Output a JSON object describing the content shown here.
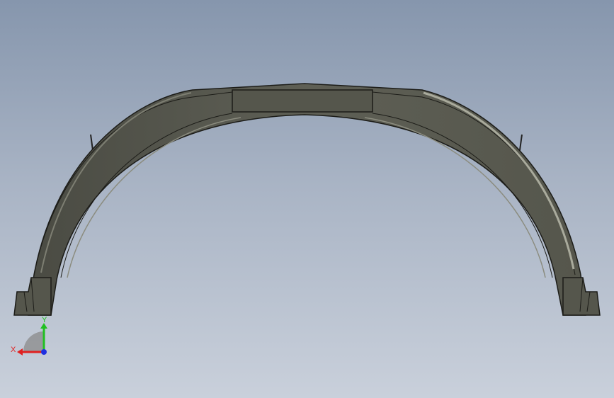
{
  "viewport": {
    "background_top": "#8696ad",
    "background_bottom": "#c9d0db"
  },
  "model": {
    "part": "arch-fender",
    "body_color": "#5b5c52",
    "edge_color": "#1c1c18",
    "highlight_color": "#a9aa9c"
  },
  "triad": {
    "x_label": "X",
    "y_label": "Y",
    "x_color": "#e02020",
    "y_color": "#20c020",
    "z_color": "#2030e0"
  }
}
